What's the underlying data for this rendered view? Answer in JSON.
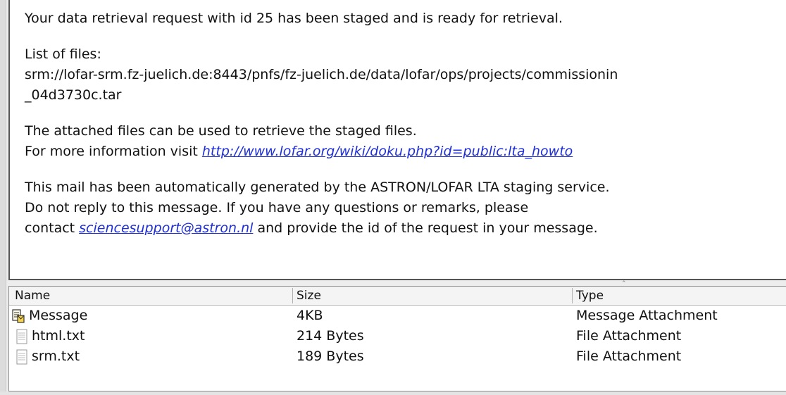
{
  "message": {
    "line1": "Your data retrieval request with id 25 has been staged and is ready for retrieval.",
    "files_label": "List of files:",
    "srm_path": "srm://lofar-srm.fz-juelich.de:8443/pnfs/fz-juelich.de/data/lofar/ops/projects/commissionin",
    "srm_tail": "_04d3730c.tar",
    "attached_text": "The attached files can be used to retrieve the staged files.",
    "info_prefix": "For more information visit ",
    "info_link": "http://www.lofar.org/wiki/doku.php?id=public:lta_howto",
    "auto_line": "This mail has been automatically generated by the ASTRON/LOFAR LTA staging service.",
    "noreply_line": "Do not reply to this message. If you have any questions or remarks, please",
    "contact_prefix": "contact ",
    "contact_email": "sciencesupport@astron.nl",
    "contact_suffix": " and provide the id of the request in your message."
  },
  "attachments": {
    "columns": {
      "name": "Name",
      "size": "Size",
      "type": "Type"
    },
    "rows": [
      {
        "name": "Message",
        "size": "4KB",
        "type": "Message Attachment",
        "icon": "message-attachment-icon"
      },
      {
        "name": "html.txt",
        "size": "214 Bytes",
        "type": "File Attachment",
        "icon": "text-file-icon"
      },
      {
        "name": "srm.txt",
        "size": "189 Bytes",
        "type": "File Attachment",
        "icon": "text-file-icon"
      }
    ]
  }
}
